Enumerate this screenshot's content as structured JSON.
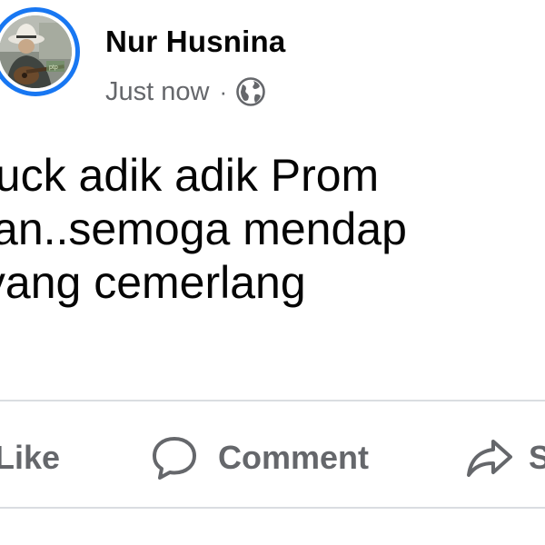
{
  "post": {
    "author": "Nur Husnina",
    "timestamp": "Just now",
    "separator": "·",
    "audience_icon": "globe-icon",
    "avatar_border_color": "#1877f2",
    "text_lines": [
      "d luck adik adik Prom",
      "alian..semoga mendap",
      "lt yang cemerlang"
    ]
  },
  "actions": {
    "like_label": "Like",
    "comment_label": "Comment",
    "share_label": "S",
    "comment_icon": "comment-icon",
    "share_icon": "share-icon"
  },
  "colors": {
    "primary_text": "#050505",
    "secondary_text": "#65676b",
    "divider": "#dadde1",
    "accent": "#1877f2"
  }
}
